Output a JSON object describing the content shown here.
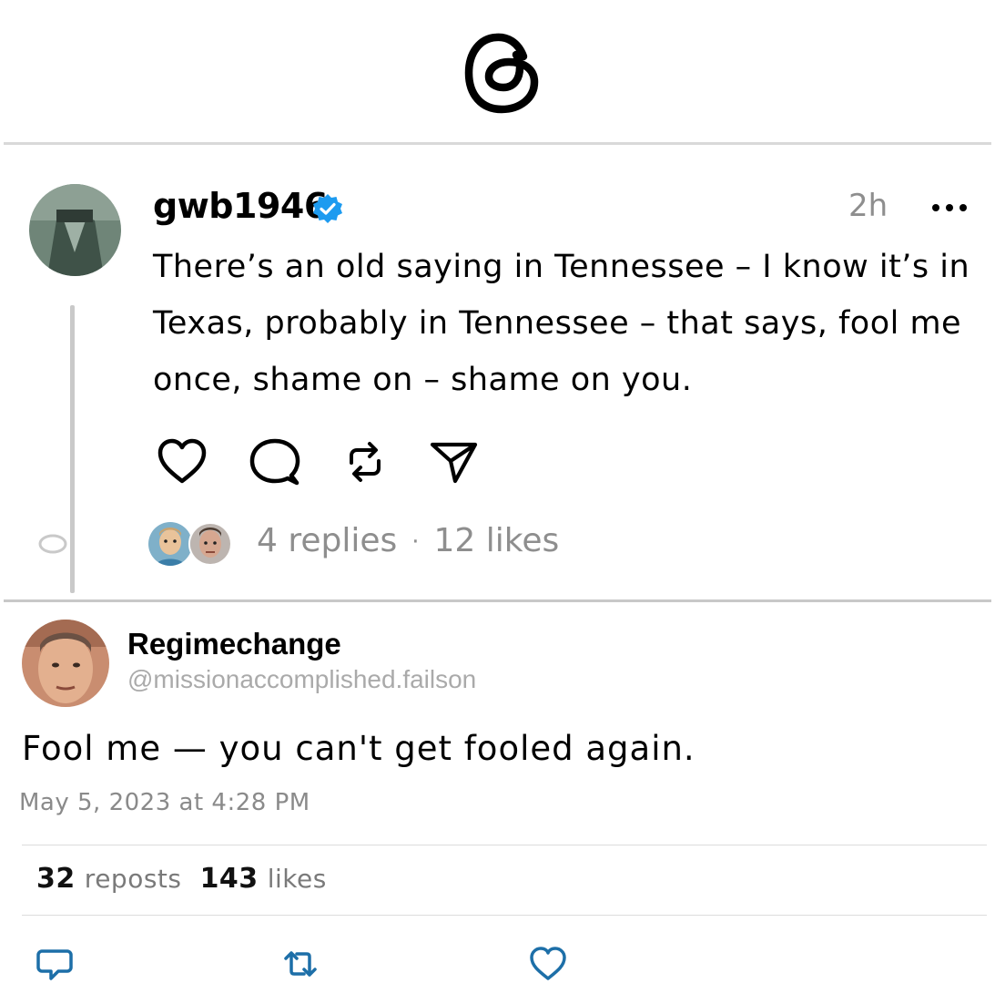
{
  "app": {
    "logo_icon": "threads-logo-icon"
  },
  "post": {
    "username": "gwb1946",
    "verified_icon": "verified-badge-icon",
    "time": "2h",
    "more_icon": "more-dots-icon",
    "text": "There’s an old saying in Tennessee – I know it’s in Texas, probably in Tennessee – that says, fool me once, shame on – shame on you.",
    "actions": [
      "heart-icon",
      "comment-icon",
      "repost-icon",
      "share-icon"
    ],
    "replies": "4 replies",
    "separator": "·",
    "likes": "12 likes"
  },
  "tweet": {
    "display_name": "Regimechange",
    "handle": "@missionaccomplished.failson",
    "text": "Fool me — you can't get fooled again.",
    "date": "May 5, 2023 at 4:28 PM",
    "reposts_count": "32",
    "reposts_label": "reposts",
    "likes_count": "143",
    "likes_label": "likes",
    "actions": [
      "reply-icon",
      "retweet-icon",
      "like-icon"
    ]
  },
  "colors": {
    "verified": "#1d9bf0",
    "muted": "#8e8e8e",
    "divider": "#d9d9d9"
  }
}
